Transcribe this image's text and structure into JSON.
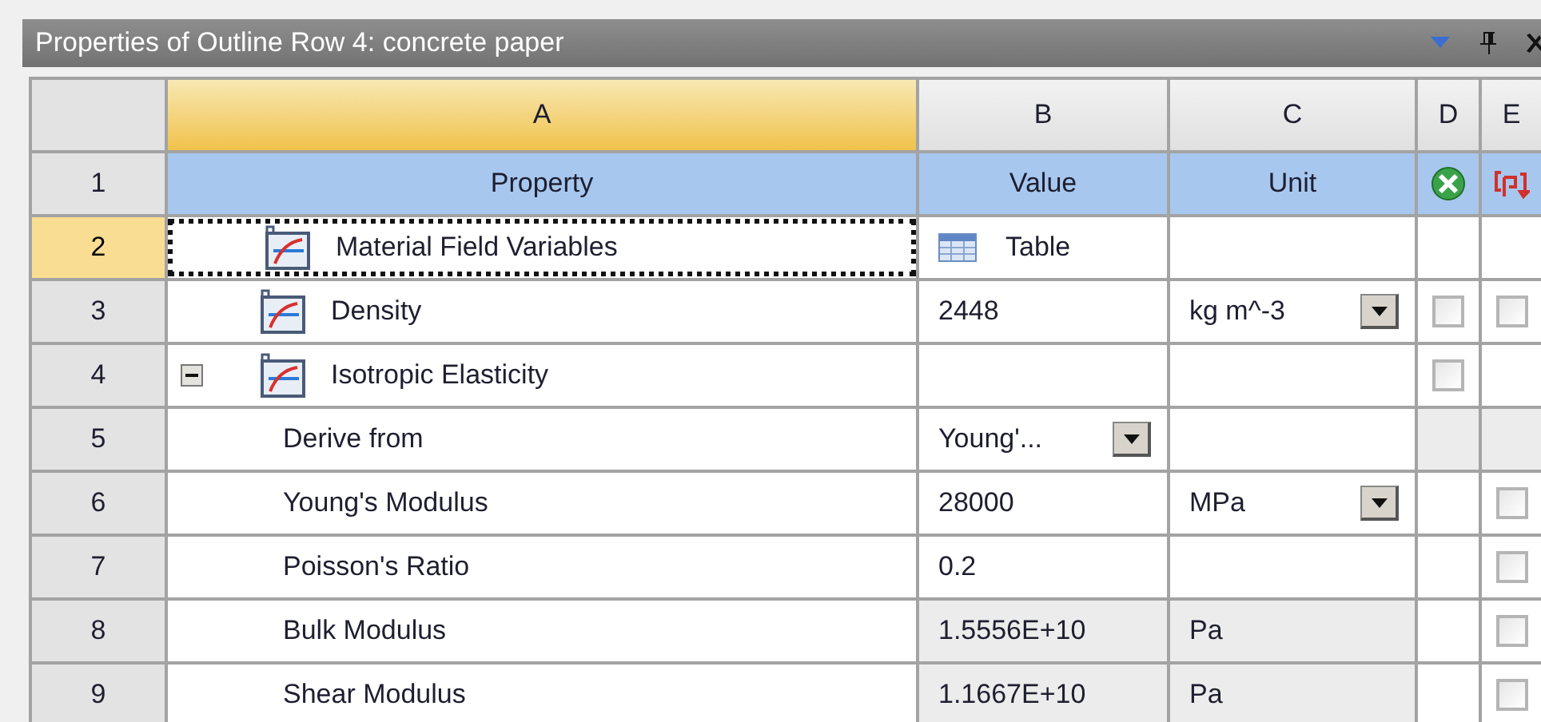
{
  "panel": {
    "title": "Properties of Outline Row 4: concrete paper"
  },
  "columns": [
    {
      "label": "A",
      "selected": true
    },
    {
      "label": "B",
      "selected": false
    },
    {
      "label": "C",
      "selected": false
    },
    {
      "label": "D",
      "selected": false
    },
    {
      "label": "E",
      "selected": false
    }
  ],
  "header_row": {
    "number": "1",
    "property": "Property",
    "value": "Value",
    "unit": "Unit"
  },
  "rows": [
    {
      "number": "2",
      "selected": true,
      "property": "Material Field Variables",
      "value": {
        "kind": "table",
        "text": "Table",
        "read_only": false
      },
      "unit": {
        "kind": "text",
        "read_only": false
      },
      "d": {
        "kind": "empty"
      },
      "e": {
        "kind": "empty"
      }
    },
    {
      "number": "3",
      "selected": false,
      "property": "Density",
      "value": {
        "kind": "text",
        "text": "2448",
        "read_only": false
      },
      "unit": {
        "kind": "dropdown",
        "text": "kg m^-3",
        "read_only": false
      },
      "d": {
        "kind": "checkbox",
        "checked": false
      },
      "e": {
        "kind": "checkbox",
        "checked": false
      }
    },
    {
      "number": "4",
      "selected": false,
      "property": "Isotropic Elasticity",
      "expanded": true,
      "value": {
        "kind": "text",
        "read_only": false
      },
      "unit": {
        "kind": "text",
        "read_only": false
      },
      "d": {
        "kind": "checkbox",
        "checked": false
      },
      "e": {
        "kind": "empty"
      },
      "children": [
        {
          "number": "5",
          "selected": false,
          "property": "Derive from",
          "value": {
            "kind": "dropdown",
            "text": "Young'...",
            "read_only": false
          },
          "unit": {
            "kind": "text",
            "read_only": false
          },
          "d": {
            "kind": "unavailable"
          },
          "e": {
            "kind": "unavailable"
          }
        },
        {
          "number": "6",
          "selected": false,
          "property": "Young's Modulus",
          "value": {
            "kind": "text",
            "text": "28000",
            "read_only": false
          },
          "unit": {
            "kind": "dropdown",
            "text": "MPa",
            "read_only": false
          },
          "d": {
            "kind": "empty"
          },
          "e": {
            "kind": "checkbox",
            "checked": false
          }
        },
        {
          "number": "7",
          "selected": false,
          "property": "Poisson's Ratio",
          "value": {
            "kind": "text",
            "text": "0.2",
            "read_only": false
          },
          "unit": {
            "kind": "text",
            "read_only": false
          },
          "d": {
            "kind": "empty"
          },
          "e": {
            "kind": "checkbox",
            "checked": false
          }
        },
        {
          "number": "8",
          "selected": false,
          "property": "Bulk Modulus",
          "value": {
            "kind": "text",
            "text": "1.5556E+10",
            "read_only": true
          },
          "unit": {
            "kind": "text",
            "text": "Pa",
            "read_only": true
          },
          "d": {
            "kind": "empty"
          },
          "e": {
            "kind": "checkbox",
            "checked": false
          }
        },
        {
          "number": "9",
          "selected": false,
          "property": "Shear Modulus",
          "value": {
            "kind": "text",
            "text": "1.1667E+10",
            "read_only": true
          },
          "unit": {
            "kind": "text",
            "text": "Pa",
            "read_only": true
          },
          "d": {
            "kind": "empty"
          },
          "e": {
            "kind": "checkbox",
            "checked": false
          }
        }
      ]
    }
  ]
}
